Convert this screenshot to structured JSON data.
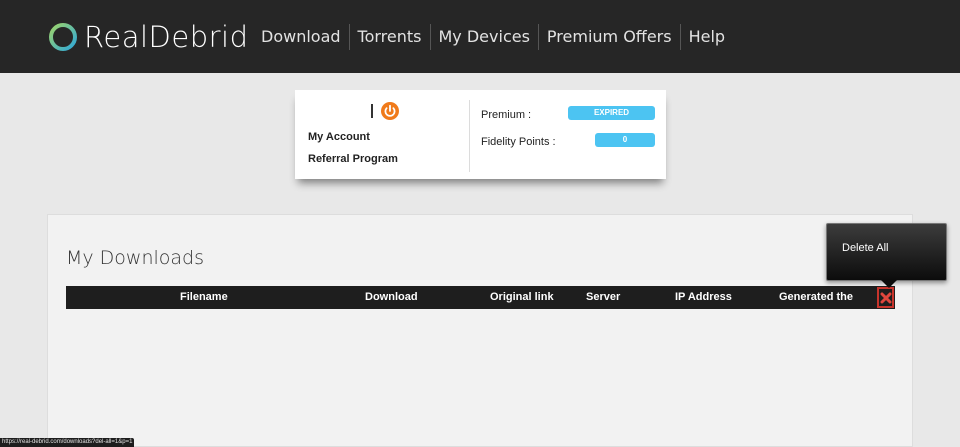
{
  "header": {
    "logo_text": "RealDebrid",
    "nav": [
      "Download",
      "Torrents",
      "My Devices",
      "Premium Offers",
      "Help"
    ]
  },
  "account": {
    "username": "",
    "links": [
      "My Account",
      "Referral Program"
    ],
    "premium_label": "Premium :",
    "premium_status": "EXPIRED",
    "fidelity_label": "Fidelity Points :",
    "fidelity_points": "0"
  },
  "downloads": {
    "title": "My Downloads",
    "columns": [
      "Filename",
      "Download",
      "Original link",
      "Server",
      "IP Address",
      "Generated the"
    ],
    "rows": []
  },
  "tooltip": {
    "text": "Delete All"
  },
  "status_bar": {
    "url": "https://real-debrid.com/downloads?del-all=1&p=1"
  },
  "colors": {
    "topbar": "#262626",
    "accent": "#4cc4f2",
    "power": "#f07a1a",
    "delete": "#c8342c"
  },
  "icons": [
    "logo-ring-icon",
    "power-icon",
    "delete-all-x-icon"
  ]
}
